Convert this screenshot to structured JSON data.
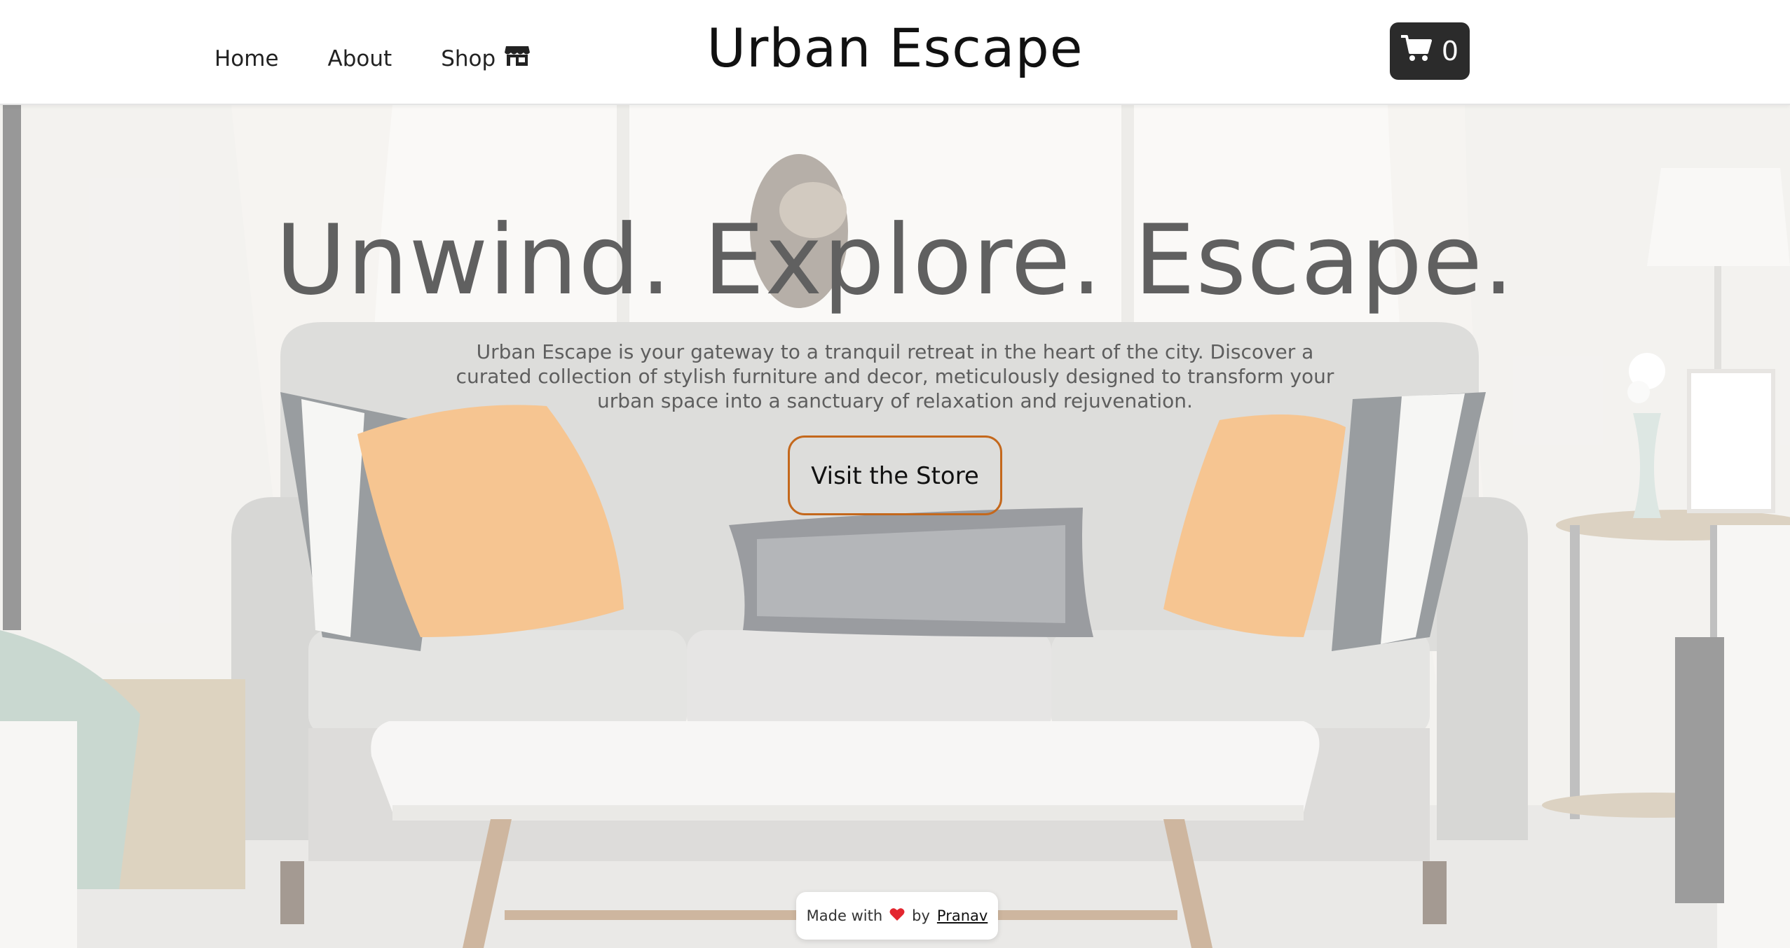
{
  "nav": {
    "links": [
      {
        "label": "Home",
        "icon": null
      },
      {
        "label": "About",
        "icon": null
      },
      {
        "label": "Shop",
        "icon": "shop-icon"
      }
    ],
    "brand": "Urban Escape",
    "cart": {
      "icon": "cart-icon",
      "count": "0"
    }
  },
  "hero": {
    "title": "Unwind. Explore. Escape.",
    "description": "Urban Escape is your gateway to a tranquil retreat in the heart of the city. Discover a curated collection of stylish furniture and decor, meticulously designed to transform your urban space into a sanctuary of relaxation and rejuvenation.",
    "cta_label": "Visit the Store"
  },
  "credit": {
    "prefix": "Made with",
    "icon": "heart-icon",
    "by": "by",
    "author": "Pranav"
  },
  "colors": {
    "accent_border": "#c4681c",
    "cart_bg": "#2b2b2b",
    "heart": "#e3262f",
    "pillow_orange": "#f0a24e"
  }
}
